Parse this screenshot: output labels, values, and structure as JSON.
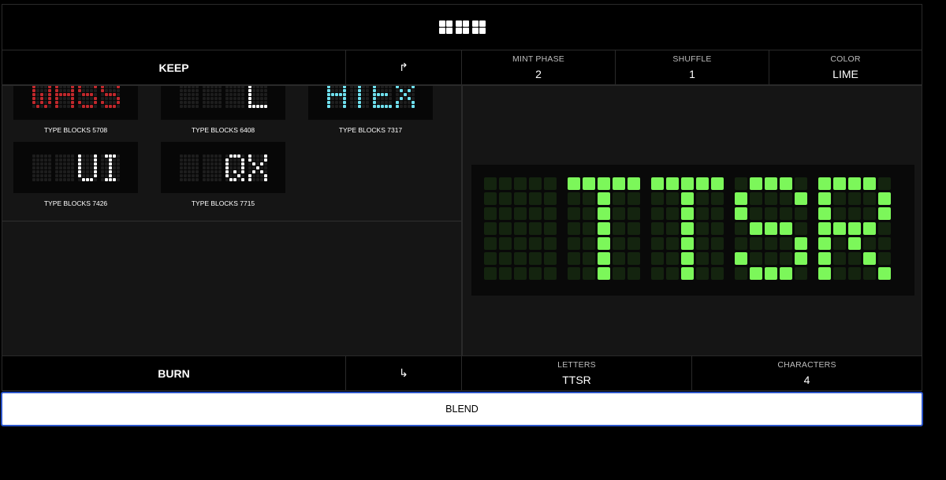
{
  "header": {
    "logo_icon": "grid-logo-icon"
  },
  "keep": {
    "label": "KEEP",
    "arrow": "↱",
    "arrow_icon": "turn-right-arrow-icon"
  },
  "burn": {
    "label": "BURN",
    "arrow": "↳",
    "arrow_icon": "turn-down-right-arrow-icon"
  },
  "stats_top": [
    {
      "label": "MINT PHASE",
      "value": "2"
    },
    {
      "label": "SHUFFLE",
      "value": "1"
    },
    {
      "label": "COLOR",
      "value": "LIME"
    }
  ],
  "stats_bottom": [
    {
      "label": "LETTERS",
      "value": "TTSR"
    },
    {
      "label": "CHARACTERS",
      "value": "4"
    }
  ],
  "cards": [
    {
      "caption": "TYPE BLOCKS 5708",
      "text": "WASS",
      "color": "#c0282c"
    },
    {
      "caption": "TYPE BLOCKS 6408",
      "text": "   L",
      "color": "#ffffff"
    },
    {
      "caption": "TYPE BLOCKS 7317",
      "text": "ATEX",
      "color": "#6fe0ee"
    },
    {
      "caption": "TYPE BLOCKS 7426",
      "text": "  UI",
      "color": "#ffffff"
    },
    {
      "caption": "TYPE BLOCKS 7715",
      "text": "  QX",
      "color": "#ffffff"
    }
  ],
  "preview": {
    "text": " TTSR",
    "color": "#7cf75a",
    "dim_color": "#14240f"
  },
  "blend": {
    "label": "BLEND"
  }
}
